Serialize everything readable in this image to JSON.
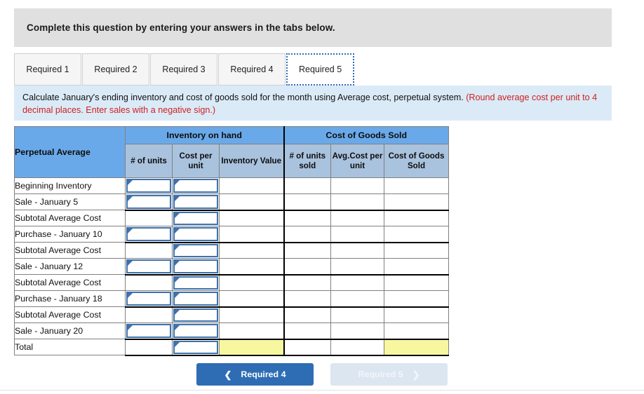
{
  "banner": {
    "text": "Complete this question by entering your answers in the tabs below."
  },
  "tabs": [
    {
      "label": "Required 1",
      "active": false
    },
    {
      "label": "Required 2",
      "active": false
    },
    {
      "label": "Required 3",
      "active": false
    },
    {
      "label": "Required 4",
      "active": false
    },
    {
      "label": "Required 5",
      "active": true
    }
  ],
  "instruction": {
    "black_text": "Calculate January's ending inventory and cost of goods sold for the month using Average cost, perpetual system. ",
    "red_text": "(Round average cost per unit to 4 decimal places. Enter sales with a negative sign.)"
  },
  "table": {
    "corner_label": "Perpetual Average",
    "group_headers": [
      {
        "label": "Inventory on hand",
        "span": 3
      },
      {
        "label": "Cost of Goods Sold",
        "span": 3
      }
    ],
    "columns": [
      "# of units",
      "Cost per unit",
      "Inventory Value",
      "# of units sold",
      "Avg.Cost per unit",
      "Cost of Goods Sold"
    ],
    "rows": [
      {
        "label": "Beginning Inventory",
        "inputs": [
          true,
          true,
          false,
          false,
          false,
          false
        ],
        "yellow": [
          false,
          false,
          false,
          false,
          false,
          false
        ],
        "thick_bottom": false
      },
      {
        "label": "Sale - January 5",
        "inputs": [
          true,
          true,
          false,
          false,
          false,
          false
        ],
        "yellow": [
          false,
          false,
          false,
          false,
          false,
          false
        ],
        "thick_bottom": true
      },
      {
        "label": "Subtotal Average Cost",
        "inputs": [
          false,
          true,
          false,
          false,
          false,
          false
        ],
        "yellow": [
          false,
          false,
          false,
          false,
          false,
          false
        ],
        "thick_bottom": false
      },
      {
        "label": "Purchase - January 10",
        "inputs": [
          true,
          true,
          false,
          false,
          false,
          false
        ],
        "yellow": [
          false,
          false,
          false,
          false,
          false,
          false
        ],
        "thick_bottom": true
      },
      {
        "label": "Subtotal Average Cost",
        "inputs": [
          false,
          true,
          false,
          false,
          false,
          false
        ],
        "yellow": [
          false,
          false,
          false,
          false,
          false,
          false
        ],
        "thick_bottom": false
      },
      {
        "label": "Sale - January 12",
        "inputs": [
          true,
          true,
          false,
          false,
          false,
          false
        ],
        "yellow": [
          false,
          false,
          false,
          false,
          false,
          false
        ],
        "thick_bottom": true
      },
      {
        "label": "Subtotal Average Cost",
        "inputs": [
          false,
          true,
          false,
          false,
          false,
          false
        ],
        "yellow": [
          false,
          false,
          false,
          false,
          false,
          false
        ],
        "thick_bottom": false
      },
      {
        "label": "Purchase - January 18",
        "inputs": [
          true,
          true,
          false,
          false,
          false,
          false
        ],
        "yellow": [
          false,
          false,
          false,
          false,
          false,
          false
        ],
        "thick_bottom": true
      },
      {
        "label": "Subtotal Average Cost",
        "inputs": [
          false,
          true,
          false,
          false,
          false,
          false
        ],
        "yellow": [
          false,
          false,
          false,
          false,
          false,
          false
        ],
        "thick_bottom": false
      },
      {
        "label": "Sale - January 20",
        "inputs": [
          true,
          true,
          false,
          false,
          false,
          false
        ],
        "yellow": [
          false,
          false,
          false,
          false,
          false,
          false
        ],
        "thick_bottom": true
      },
      {
        "label": "Total",
        "inputs": [
          false,
          true,
          false,
          false,
          false,
          false
        ],
        "yellow": [
          false,
          false,
          true,
          false,
          false,
          true
        ],
        "thick_bottom": true
      }
    ]
  },
  "nav": {
    "prev_label": "Required 4",
    "prev_icon": "chevron-left-icon",
    "next_label": "Required 5",
    "next_icon": "chevron-right-icon"
  },
  "colors": {
    "header_blue": "#6aa9e9",
    "subheader_blue": "#a9c2de",
    "instruction_bg": "#dbeaf7",
    "banner_gray": "#e0e0e0",
    "input_border": "#3d72ab",
    "yellow_cell": "#f7f79f",
    "primary_button": "#2e6db4",
    "disabled_button": "#dce6f1",
    "red_text": "#d01f1f"
  }
}
